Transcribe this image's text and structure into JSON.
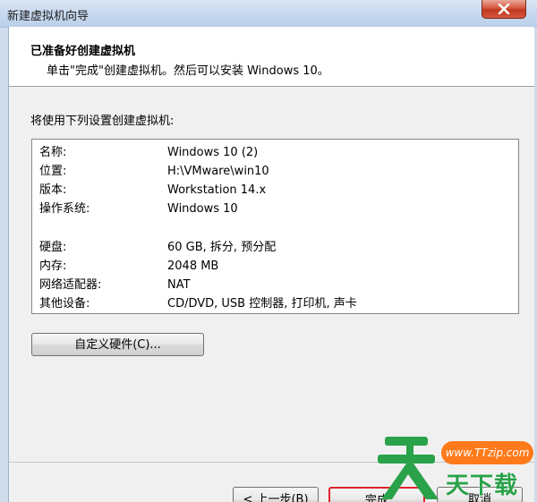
{
  "window": {
    "title": "新建虚拟机向导"
  },
  "header": {
    "title": "已准备好创建虚拟机",
    "subtitle": "单击\"完成\"创建虚拟机。然后可以安装 Windows 10。"
  },
  "intro_text": "将使用下列设置创建虚拟机:",
  "summary": {
    "rows": [
      {
        "label": "名称:",
        "value": "Windows 10 (2)"
      },
      {
        "label": "位置:",
        "value": "H:\\VMware\\win10"
      },
      {
        "label": "版本:",
        "value": "Workstation 14.x"
      },
      {
        "label": "操作系统:",
        "value": "Windows 10"
      },
      {
        "label": "硬盘:",
        "value": "60 GB, 拆分, 预分配"
      },
      {
        "label": "内存:",
        "value": "2048 MB"
      },
      {
        "label": "网络适配器:",
        "value": "NAT"
      },
      {
        "label": "其他设备:",
        "value": "CD/DVD, USB 控制器, 打印机, 声卡"
      }
    ]
  },
  "buttons": {
    "customize": "自定义硬件(C)...",
    "back": "< 上一步(B)",
    "finish": "完成",
    "cancel": "取消"
  },
  "watermark": {
    "url": "www.TTzip.com",
    "brand": "天下载",
    "color": "#2aa24a",
    "accent": "#ff7a1a"
  },
  "colors": {
    "finish_highlight": "#e0242c",
    "close_button": "#c0391f"
  }
}
